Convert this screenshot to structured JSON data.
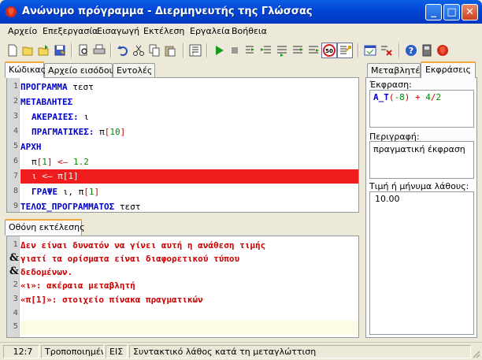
{
  "window": {
    "title": "Ανώνυμο πρόγραμμα - Διερμηνευτής της Γλώσσας"
  },
  "menu": [
    "Αρχείο",
    "Επεξεργασία",
    "Εισαγωγή",
    "Εκτέλεση",
    "Εργαλεία",
    "Βοήθεια"
  ],
  "toolbar": {
    "speed_label": "50"
  },
  "left_tabs": [
    "Κώδικας",
    "Αρχείο εισόδου",
    "Εντολές"
  ],
  "code": {
    "line_numbers": [
      "1",
      "2",
      "3",
      "4",
      "5",
      "6",
      "7",
      "8",
      "9"
    ],
    "l1_kw": "ΠΡΟΓΡΑΜΜΑ",
    "l1_rest": " τεστ",
    "l2_kw": "ΜΕΤΑΒΛΗΤΕΣ",
    "l3_kw": "ΑΚΕΡΑΙΕΣ:",
    "l3_rest": " ι",
    "l4_kw": "ΠΡΑΓΜΑΤΙΚΕΣ:",
    "l4_a": " π",
    "l4_b": "[",
    "l4_num": "10",
    "l4_c": "]",
    "l5_kw": "ΑΡΧΗ",
    "l6_a": "π",
    "l6_b": "[",
    "l6_num": "1",
    "l6_c": "]",
    "l6_arrow": " <— ",
    "l6_val": "1.2",
    "l7_text": "ι <— π[1]",
    "l8_kw": "ΓΡΑΨΕ",
    "l8_a": " ι, π",
    "l8_b": "[",
    "l8_num": "1",
    "l8_c": "]",
    "l9_kw": "ΤΕΛΟΣ_ΠΡΟΓΡΑΜΜΑΤΟΣ",
    "l9_rest": " τεστ"
  },
  "output": {
    "tab": "Οθόνη εκτέλεσης",
    "line_numbers": [
      "1",
      "2",
      "3",
      "4",
      "5"
    ],
    "cont_marker": "&",
    "lines": [
      "Δεν είναι δυνατόν να γίνει αυτή η ανάθεση τιμής",
      "γιατί τα ορίσματα είναι διαφορετικού τύπου",
      "δεδομένων.",
      "«ι»: ακέραια μεταβλητή",
      "«π[1]»: στοιχείο πίνακα πραγματικών"
    ]
  },
  "right_tabs": [
    "Μεταβλητές",
    "Εκφράσεις"
  ],
  "expr": {
    "label": "Έκφραση:",
    "fn": "A_T",
    "p1": "(",
    "neg": "-8",
    "p2": ")",
    "plus": " + ",
    "n4": "4",
    "slash": "/",
    "n2": "2",
    "desc_label": "Περιγραφή:",
    "desc": "πραγματική έκφραση",
    "value_label": "Τιμή ή μήνυμα λάθους:",
    "value": "10.00"
  },
  "status": {
    "pos": "12:7",
    "state": "Τροποποιημένο",
    "mode": "ΕΙΣ",
    "message": "Συντακτικό λάθος κατά τη μεταγλώττιση"
  }
}
